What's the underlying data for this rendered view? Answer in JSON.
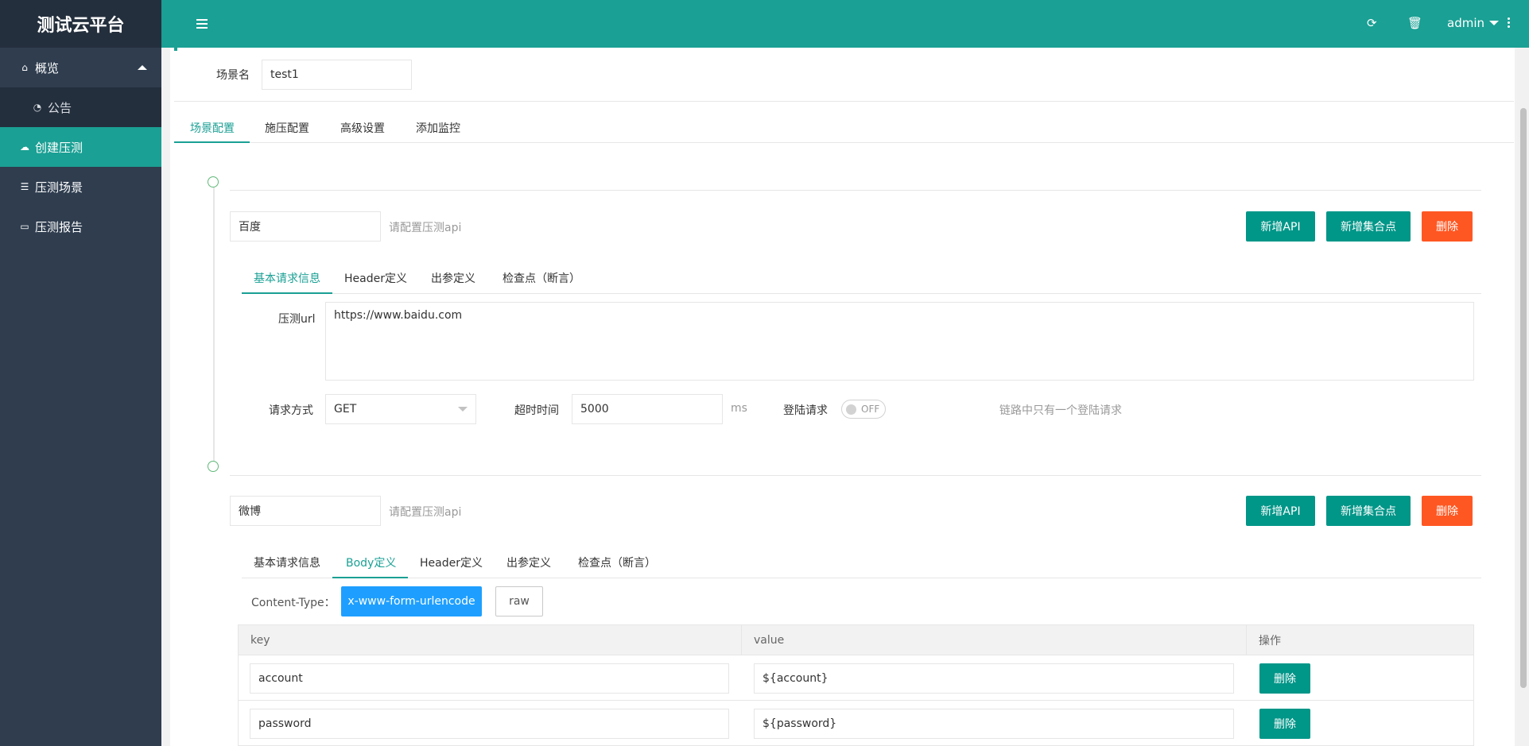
{
  "app": {
    "title": "测试云平台"
  },
  "sidebar": {
    "items": [
      {
        "label": "概览",
        "icon": "home-icon"
      },
      {
        "label": "公告",
        "icon": "dashboard-icon"
      },
      {
        "label": "创建压测",
        "icon": "cloud-icon"
      },
      {
        "label": "压测场景",
        "icon": "server-icon"
      },
      {
        "label": "压测报告",
        "icon": "monitor-icon"
      }
    ]
  },
  "header": {
    "user": "admin"
  },
  "scene": {
    "label": "场景名",
    "value": "test1"
  },
  "tabs": [
    "场景配置",
    "施压配置",
    "高级设置",
    "添加监控"
  ],
  "api1": {
    "name": "百度",
    "hint": "请配置压测api",
    "add_api": "新增API",
    "add_rendezvous": "新增集合点",
    "delete": "删除",
    "tabs": [
      "基本请求信息",
      "Header定义",
      "出参定义",
      "检查点（断言）"
    ],
    "url_label": "压测url",
    "url": "https://www.baidu.com",
    "method_label": "请求方式",
    "method": "GET",
    "timeout_label": "超时时间",
    "timeout": "5000",
    "timeout_unit": "ms",
    "login_label": "登陆请求",
    "login_switch": "OFF",
    "login_note": "链路中只有一个登陆请求"
  },
  "api2": {
    "name": "微博",
    "hint": "请配置压测api",
    "add_api": "新增API",
    "add_rendezvous": "新增集合点",
    "delete": "删除",
    "tabs": [
      "基本请求信息",
      "Body定义",
      "Header定义",
      "出参定义",
      "检查点（断言）"
    ],
    "content_type_label": "Content-Type：",
    "content_types": [
      "x-www-form-urlencode",
      "raw"
    ],
    "table": {
      "headers": [
        "key",
        "value",
        "操作"
      ],
      "rows": [
        {
          "key": "account",
          "value": "${account}",
          "action": "删除"
        },
        {
          "key": "password",
          "value": "${password}",
          "action": "删除"
        }
      ]
    }
  }
}
